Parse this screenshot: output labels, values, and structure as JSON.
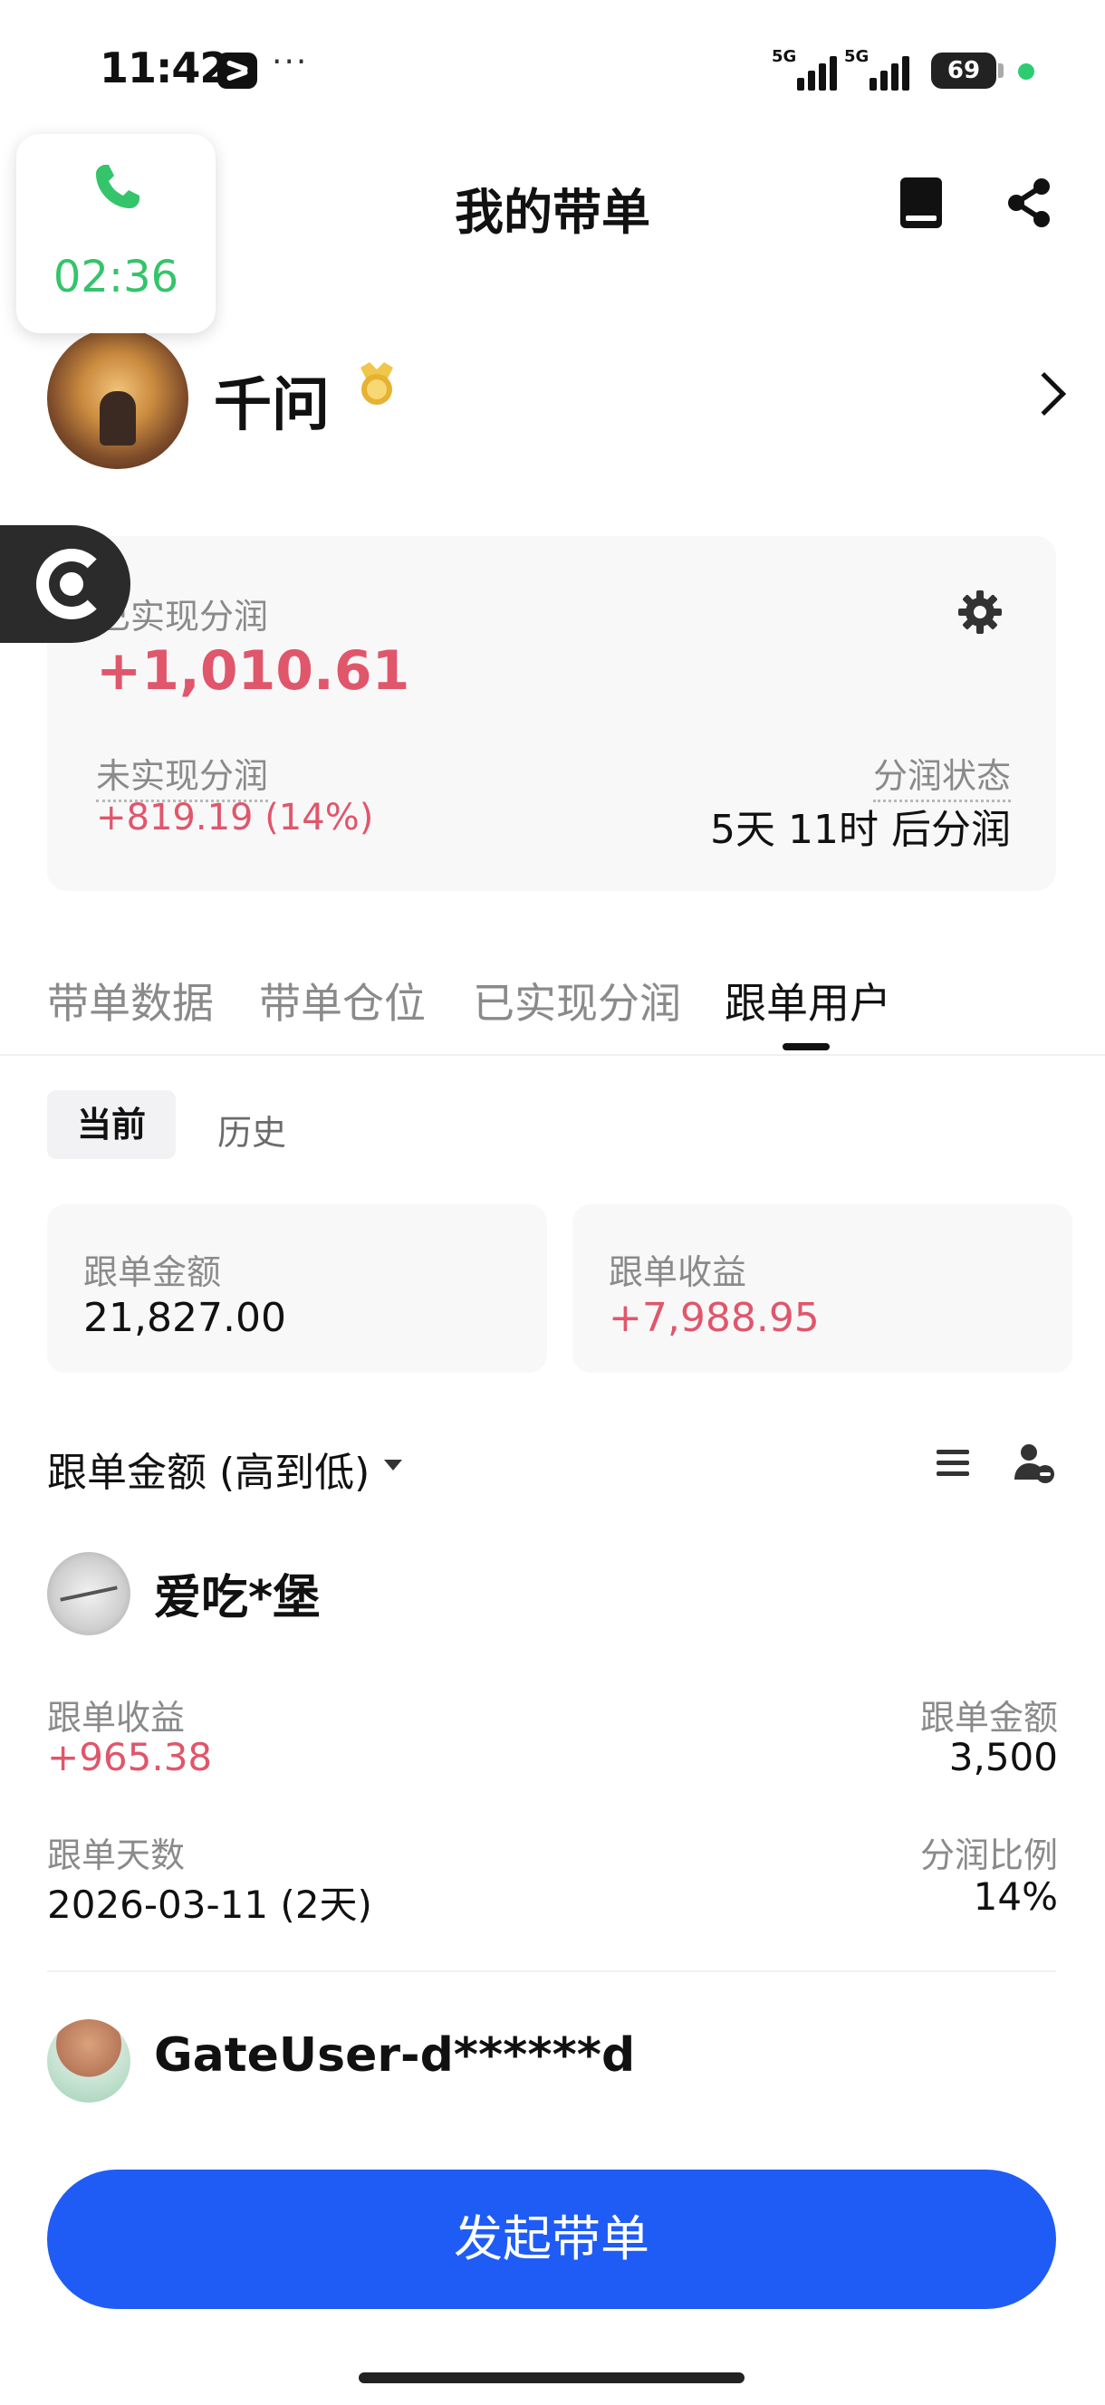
{
  "status_bar": {
    "time": "11:42",
    "more": "···",
    "signal_1_label": "5G",
    "signal_2_label": "5G",
    "battery": "69"
  },
  "call": {
    "duration": "02:36"
  },
  "header": {
    "title": "我的带单"
  },
  "profile": {
    "name": "千问"
  },
  "profit": {
    "realized_label": "已实现分润",
    "realized_value": "+1,010.61",
    "unrealized_label": "未实现分润",
    "unrealized_value": "+819.19 (14%)",
    "status_label": "分润状态",
    "status_value": "5天 11时 后分润"
  },
  "tabs": [
    {
      "label": "带单数据",
      "active": false
    },
    {
      "label": "带单仓位",
      "active": false
    },
    {
      "label": "已实现分润",
      "active": false
    },
    {
      "label": "跟单用户",
      "active": true
    }
  ],
  "segments": {
    "current": "当前",
    "history": "历史"
  },
  "stats": {
    "amount_label": "跟单金额",
    "amount_value": "21,827.00",
    "profit_label": "跟单收益",
    "profit_value": "+7,988.95"
  },
  "sort": {
    "label": "跟单金额 (高到低)"
  },
  "followers": [
    {
      "name": "爱吃*堡",
      "profit_label": "跟单收益",
      "profit_value": "+965.38",
      "amount_label": "跟单金额",
      "amount_value": "3,500",
      "days_label": "跟单天数",
      "days_value": "2026-03-11 (2天)",
      "ratio_label": "分润比例",
      "ratio_value": "14%"
    },
    {
      "name": "GateUser-d******d"
    }
  ],
  "cta": {
    "label": "发起带单"
  },
  "colors": {
    "accent_blue": "#1f5cf6",
    "profit_red": "#e0566b",
    "call_green": "#34c46a"
  }
}
